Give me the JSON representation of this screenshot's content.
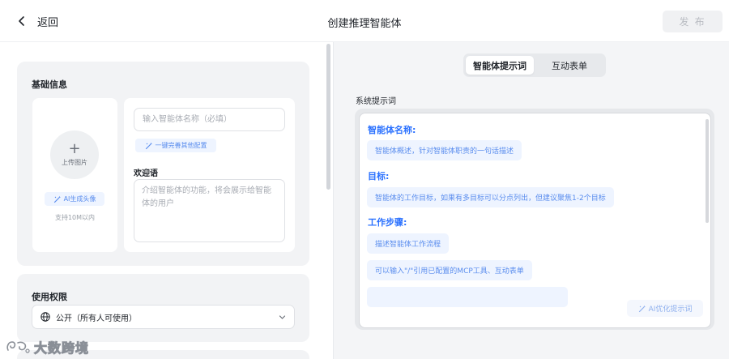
{
  "header": {
    "back_label": "返回",
    "title": "创建推理智能体",
    "publish_label": "发 布"
  },
  "basic_info": {
    "section_title": "基础信息",
    "upload_label": "上传图片",
    "ai_avatar_label": "AI生成头像",
    "avatar_hint": "支持10M以内",
    "name_placeholder": "输入智能体名称（必填）",
    "complete_config_label": "一键完善其他配置",
    "welcome_title": "欢迎语",
    "welcome_placeholder": "介绍智能体的功能，将会展示给智能体的用户"
  },
  "permissions": {
    "section_title": "使用权限",
    "selected_value": "公开（所有人可使用）"
  },
  "tabs": [
    {
      "label": "智能体提示词",
      "active": true
    },
    {
      "label": "互动表单",
      "active": false
    }
  ],
  "prompt": {
    "label": "系统提示词",
    "sections": [
      {
        "heading": "智能体名称:",
        "chips": [
          "智能体概述，针对智能体职责的一句话描述"
        ]
      },
      {
        "heading": "目标:",
        "chips": [
          "智能体的工作目标，如果有多目标可以分点列出，但建议聚焦1-2个目标"
        ]
      },
      {
        "heading": "工作步骤:",
        "chips": [
          "描述智能体工作流程",
          "可以输入\"/\"引用已配置的MCP工具、互动表单"
        ]
      }
    ],
    "ai_optimize_label": "AI优化提示词"
  },
  "watermark": {
    "text": "大数跨境"
  },
  "colors": {
    "accent": "#2970ff",
    "chip_bg": "#eef4ff",
    "chip_text": "#5a8dee",
    "card_bg": "#f2f3f5",
    "right_pane_bg": "#f4f5f7"
  }
}
